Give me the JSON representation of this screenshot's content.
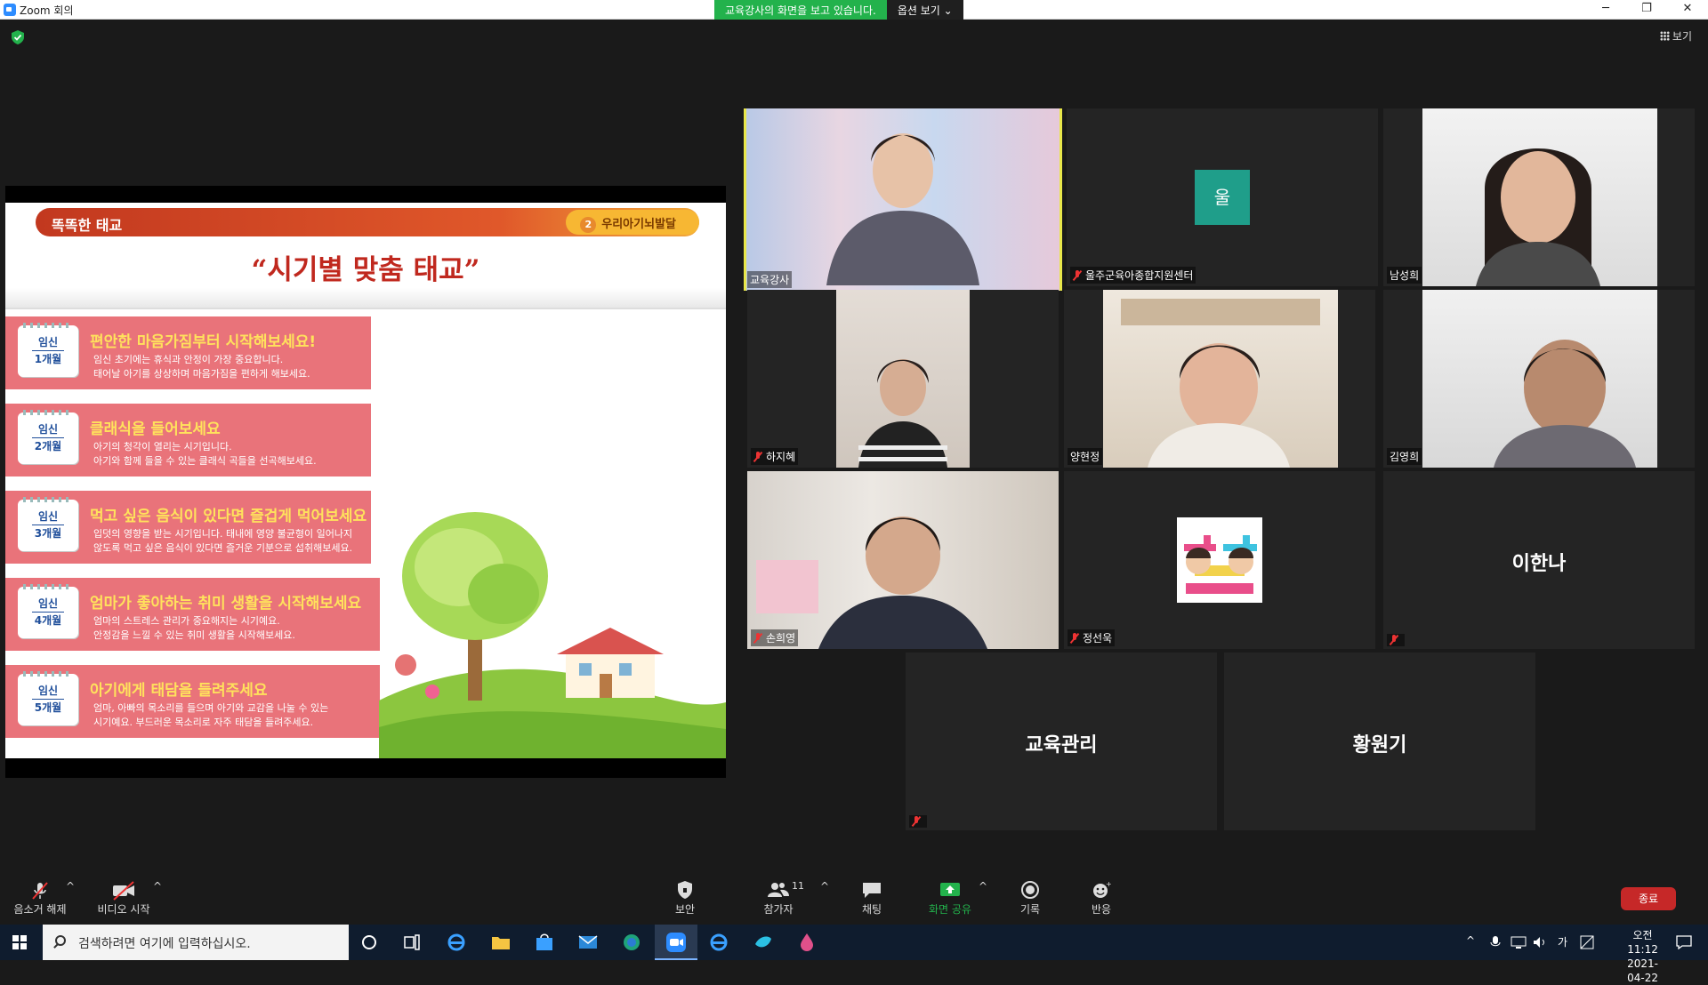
{
  "titlebar": {
    "title": "Zoom 회의",
    "share_msg": "교육강사의 화면을 보고 있습니다.",
    "view_options": "옵션 보기 ⌄",
    "minimize": "─",
    "restore": "❐",
    "close": "✕"
  },
  "meeting": {
    "view_label": "보기"
  },
  "slide": {
    "header_left": "똑똑한 태교",
    "header_badge_num": "2",
    "header_right": "우리아기뇌발달",
    "title": "“시기별 맞춤 태교”",
    "items": [
      {
        "cal_top": "임신",
        "cal_bottom": "1개월",
        "head": "편안한 마음가짐부터 시작해보세요!",
        "d1": "임신 초기에는 휴식과 안정이 가장 중요합니다.",
        "d2": "태어날 아기를 상상하며 마음가짐을 편하게 해보세요."
      },
      {
        "cal_top": "임신",
        "cal_bottom": "2개월",
        "head": "클래식을 들어보세요",
        "d1": "아기의 청각이 열리는 시기입니다.",
        "d2": "아기와 함께 들을 수 있는 클래식 곡들을 선곡해보세요."
      },
      {
        "cal_top": "임신",
        "cal_bottom": "3개월",
        "head": "먹고 싶은 음식이 있다면 즐겁게 먹어보세요",
        "d1": "입덧의 영향을 받는 시기입니다. 태내에 영양 불균형이 일어나지",
        "d2": "않도록 먹고 싶은 음식이 있다면 즐거운 기분으로 섭취해보세요."
      },
      {
        "cal_top": "임신",
        "cal_bottom": "4개월",
        "head": "엄마가 좋아하는 취미 생활을 시작해보세요",
        "d1": "엄마의 스트레스 관리가 중요해지는 시기예요.",
        "d2": "안정감을 느낄 수 있는 취미 생활을 시작해보세요."
      },
      {
        "cal_top": "임신",
        "cal_bottom": "5개월",
        "head": "아기에게 태담을 들려주세요",
        "d1": "엄마, 아빠의 목소리를 들으며 아기와 교감을 나눌 수 있는",
        "d2": "시기예요. 부드러운 목소리로 자주 태담을 들려주세요."
      }
    ]
  },
  "participants": [
    {
      "name": "교육강사",
      "muted": false,
      "type": "video"
    },
    {
      "name": "울주군육아종합지원센터",
      "muted": true,
      "type": "letter",
      "letter": "울"
    },
    {
      "name": "남성희",
      "muted": false,
      "type": "video"
    },
    {
      "name": "하지혜",
      "muted": true,
      "type": "video"
    },
    {
      "name": "양현정",
      "muted": false,
      "type": "video"
    },
    {
      "name": "김영희",
      "muted": false,
      "type": "video"
    },
    {
      "name": "손희영",
      "muted": true,
      "type": "video"
    },
    {
      "name": "정선욱",
      "muted": true,
      "type": "image"
    },
    {
      "name": "이한나",
      "muted": true,
      "type": "name"
    },
    {
      "name": "교육관리",
      "muted": true,
      "type": "name"
    },
    {
      "name": "황원기",
      "muted": false,
      "type": "name"
    }
  ],
  "toolbar": {
    "unmute": "음소거 해제",
    "start_video": "비디오 시작",
    "security": "보안",
    "participants": "참가자",
    "participants_count": "11",
    "chat": "채팅",
    "share_screen": "화면 공유",
    "record": "기록",
    "reactions": "반응",
    "end": "종료",
    "caret": "^"
  },
  "taskbar": {
    "search_placeholder": "검색하려면 여기에 입력하십시오.",
    "time": "오전 11:12",
    "date": "2021-04-22",
    "ime": "가",
    "caret": "^"
  },
  "colors": {
    "share_green": "#23b24c",
    "active_speaker": "#e8e74a",
    "end_red": "#c62828",
    "accent_blue": "#2d8cff"
  }
}
